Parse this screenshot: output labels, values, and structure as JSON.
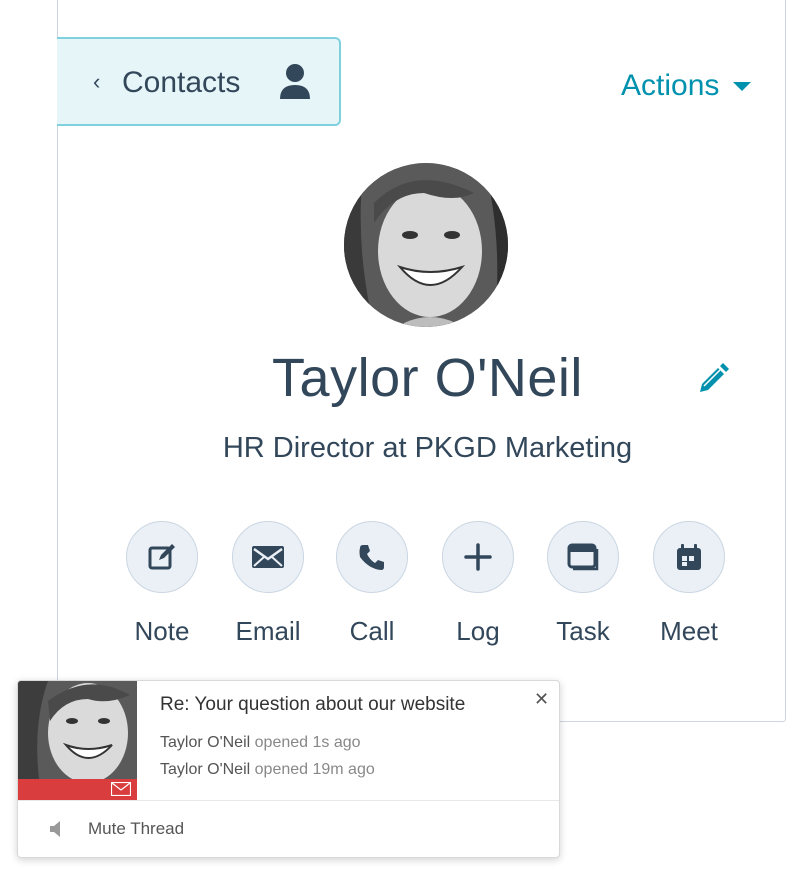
{
  "header": {
    "back_label": "Contacts",
    "actions_label": "Actions"
  },
  "contact": {
    "name": "Taylor O'Neil",
    "title": "HR Director at PKGD Marketing"
  },
  "actions": [
    {
      "label": "Note",
      "icon": "note-icon"
    },
    {
      "label": "Email",
      "icon": "email-icon"
    },
    {
      "label": "Call",
      "icon": "phone-icon"
    },
    {
      "label": "Log",
      "icon": "plus-icon"
    },
    {
      "label": "Task",
      "icon": "task-icon"
    },
    {
      "label": "Meet",
      "icon": "calendar-icon"
    }
  ],
  "notification": {
    "subject": "Re: Your question about our website",
    "events": [
      {
        "who": "Taylor O'Neil",
        "what": "opened 1s ago"
      },
      {
        "who": "Taylor O'Neil",
        "what": "opened 19m ago"
      }
    ],
    "mute_label": "Mute Thread"
  },
  "colors": {
    "accent": "#0091ae",
    "text": "#33475b",
    "back_button_bg": "#e5f5f8",
    "notification_bar": "#d93d3d"
  }
}
